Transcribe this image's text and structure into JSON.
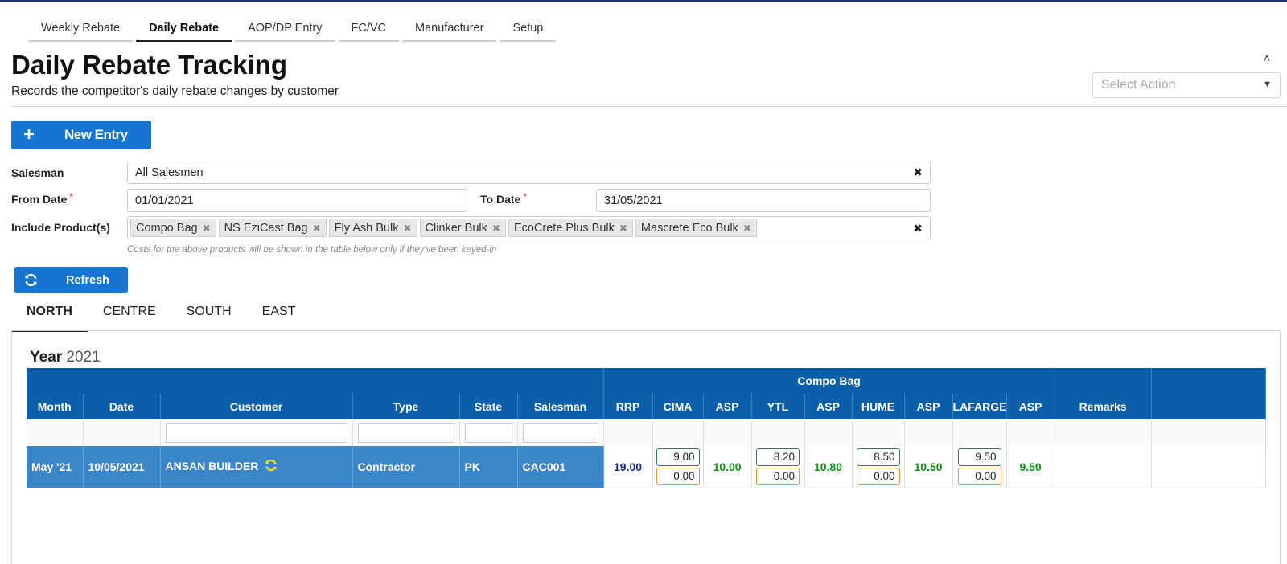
{
  "top_tabs": [
    "Weekly Rebate",
    "Daily Rebate",
    "AOP/DP Entry",
    "FC/VC",
    "Manufacturer",
    "Setup"
  ],
  "page": {
    "title": "Daily Rebate Tracking",
    "subtitle": "Records the competitor's daily rebate changes by customer",
    "select_action_placeholder": "Select Action"
  },
  "buttons": {
    "new_entry": "New Entry",
    "refresh": "Refresh"
  },
  "form": {
    "salesman_label": "Salesman",
    "salesman_value": "All Salesmen",
    "from_date_label": "From Date",
    "from_date_value": "01/01/2021",
    "to_date_label": "To Date",
    "to_date_value": "31/05/2021",
    "required_mark": "*",
    "products_label": "Include Product(s)",
    "products": [
      "Compo Bag",
      "NS EziCast Bag",
      "Fly Ash Bulk",
      "Clinker Bulk",
      "EcoCrete Plus Bulk",
      "Mascrete Eco Bulk"
    ],
    "hint": "Costs for the above products will be shown in the table below only if they've been keyed-in"
  },
  "region_tabs": [
    "NORTH",
    "CENTRE",
    "SOUTH",
    "EAST"
  ],
  "year": {
    "label": "Year",
    "value": "2021"
  },
  "table": {
    "group_header": "Compo Bag",
    "columns": [
      "Month",
      "Date",
      "Customer",
      "Type",
      "State",
      "Salesman",
      "RRP",
      "CIMA",
      "ASP",
      "YTL",
      "ASP",
      "HUME",
      "ASP",
      "LAFARGE",
      "ASP",
      "Remarks"
    ],
    "rows": [
      {
        "month": "May '21",
        "date": "10/05/2021",
        "customer": "ANSAN BUILDER",
        "type": "Contractor",
        "state": "PK",
        "salesman": "CAC001",
        "rrp": "19.00",
        "cima": [
          "9.00",
          "0.00"
        ],
        "cima_asp": "10.00",
        "ytl": [
          "8.20",
          "0.00"
        ],
        "ytl_asp": "10.80",
        "hume": [
          "8.50",
          "0.00"
        ],
        "hume_asp": "10.50",
        "lafarge": [
          "9.50",
          "0.00"
        ],
        "lafarge_asp": "9.50",
        "remarks": ""
      }
    ]
  },
  "colors": {
    "primary": "#1675d0",
    "header": "#0a5fa8",
    "selected_row": "#3a86c8",
    "asp_green": "#1a8a1a",
    "rrp_navy": "#1a2e88"
  }
}
